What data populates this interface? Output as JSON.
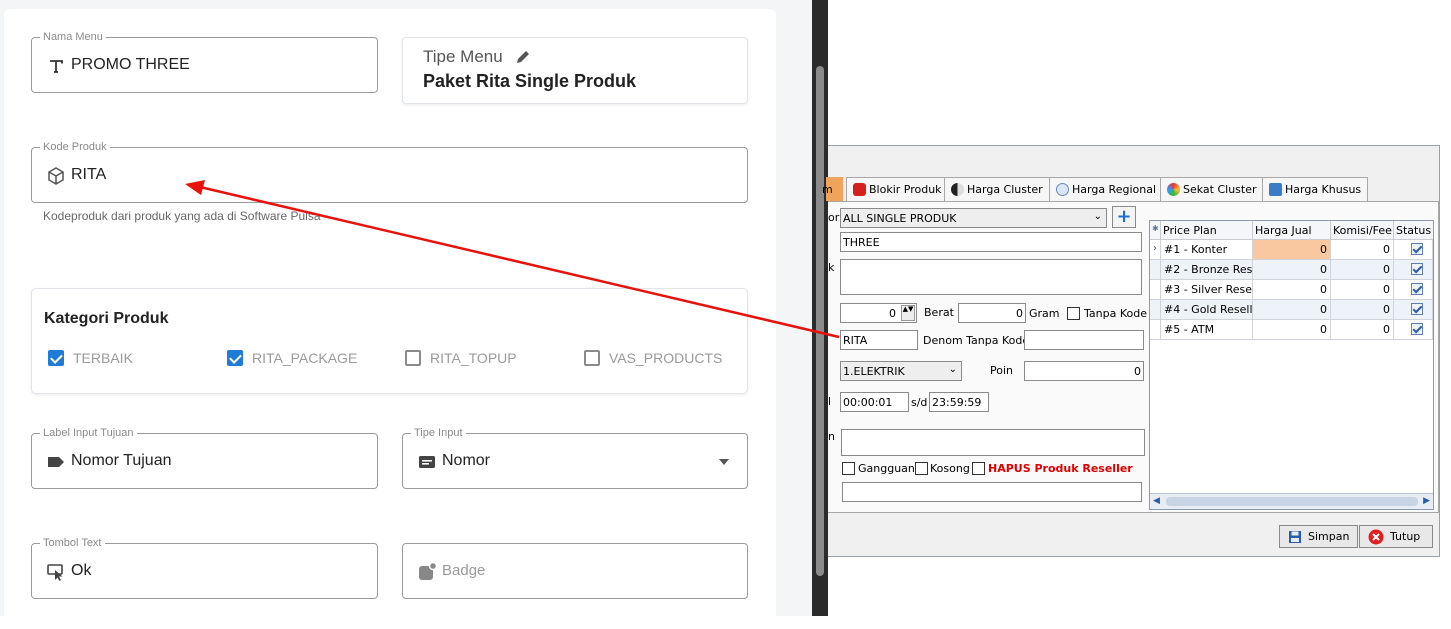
{
  "form": {
    "nama_menu": {
      "label": "Nama Menu",
      "value": "PROMO THREE"
    },
    "tipe_menu": {
      "label": "Tipe Menu",
      "value": "Paket Rita Single Produk"
    },
    "kode_produk": {
      "label": "Kode Produk",
      "value": "RITA",
      "help": "Kodeproduk dari produk yang ada di Software Pulsa"
    },
    "kategori": {
      "title": "Kategori Produk",
      "items": [
        {
          "label": "TERBAIK",
          "checked": true
        },
        {
          "label": "RITA_PACKAGE",
          "checked": true
        },
        {
          "label": "RITA_TOPUP",
          "checked": false
        },
        {
          "label": "VAS_PRODUCTS",
          "checked": false
        }
      ]
    },
    "label_input": {
      "label": "Label Input Tujuan",
      "value": "Nomor Tujuan"
    },
    "tipe_input": {
      "label": "Tipe Input",
      "value": "Nomor"
    },
    "tombol_text": {
      "label": "Tombol Text",
      "value": "Ok"
    },
    "badge": {
      "placeholder": "Badge"
    }
  },
  "desktop": {
    "tabs": [
      {
        "label": "m",
        "icon": "product-icon"
      },
      {
        "label": "Blokir Produk",
        "icon": "hand-stop-icon"
      },
      {
        "label": "Harga Cluster",
        "icon": "yin-yang-icon"
      },
      {
        "label": "Harga Regional",
        "icon": "globe-icon"
      },
      {
        "label": "Sekat Cluster",
        "icon": "circle-icon"
      },
      {
        "label": "Harga Khusus",
        "icon": "dollar-icon"
      }
    ],
    "kategori_label": "ori",
    "kategori_value": "ALL SINGLE PRODUK",
    "nama_value": "THREE",
    "ket_label": "k",
    "berat_value": "0",
    "berat_label": "Berat",
    "berat_input": "0",
    "gram_label": "Gram",
    "tanpa_kode_label": "Tanpa Kode",
    "kode_value": "RITA",
    "denom_label": "Denom Tanpa Kode",
    "tipe_value": "1.ELEKTRIK",
    "poin_label": "Poin",
    "poin_value": "0",
    "jam_label": "l",
    "jam_start": "00:00:01",
    "sd_label": "s/d",
    "jam_end": "23:59:59",
    "note_label": "n",
    "gangguan_label": "Gangguan",
    "kosong_label": "Kosong",
    "hapus_label": "HAPUS Produk Reseller",
    "grid": {
      "headers": [
        "Price Plan",
        "Harga Jual",
        "Komisi/Fee",
        "Status"
      ],
      "rows": [
        {
          "plan": "#1 - Konter",
          "harga": "0",
          "komisi": "0",
          "status": true
        },
        {
          "plan": "#2 - Bronze Resel",
          "harga": "0",
          "komisi": "0",
          "status": true
        },
        {
          "plan": "#3 - Silver Reselle",
          "harga": "0",
          "komisi": "0",
          "status": true
        },
        {
          "plan": "#4 - Gold Reseller",
          "harga": "0",
          "komisi": "0",
          "status": true
        },
        {
          "plan": "#5 -  ATM",
          "harga": "0",
          "komisi": "0",
          "status": true
        }
      ]
    },
    "simpan_label": "Simpan",
    "tutup_label": "Tutup"
  },
  "colors": {
    "accent": "#1e7bd8",
    "arrow": "#e8120c",
    "highlight": "#f9c8a0",
    "hapus": "#e00000"
  }
}
